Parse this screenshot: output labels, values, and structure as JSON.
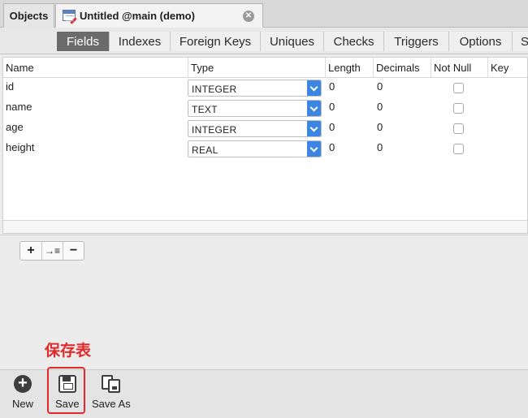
{
  "doc_tabs": {
    "objects_label": "Objects",
    "active_label": "Untitled @main (demo)"
  },
  "sub_tabs": [
    "Fields",
    "Indexes",
    "Foreign Keys",
    "Uniques",
    "Checks",
    "Triggers",
    "Options",
    "S"
  ],
  "active_sub_tab": "Fields",
  "grid": {
    "columns": [
      "Name",
      "Type",
      "Length",
      "Decimals",
      "Not Null",
      "Key"
    ],
    "rows": [
      {
        "name": "id",
        "type": "INTEGER",
        "length": "0",
        "decimals": "0",
        "not_null": false
      },
      {
        "name": "name",
        "type": "TEXT",
        "length": "0",
        "decimals": "0",
        "not_null": false
      },
      {
        "name": "age",
        "type": "INTEGER",
        "length": "0",
        "decimals": "0",
        "not_null": false
      },
      {
        "name": "height",
        "type": "REAL",
        "length": "0",
        "decimals": "0",
        "not_null": false
      }
    ]
  },
  "row_tools": {
    "add": "+",
    "insert": "→≡",
    "remove": "−"
  },
  "annotation": "保存表",
  "toolbar": {
    "new_label": "New",
    "save_label": "Save",
    "save_as_label": "Save As"
  },
  "colors": {
    "accent": "#3b86e3",
    "highlight": "#e02a2a",
    "active_tab": "#6b6b6b"
  }
}
